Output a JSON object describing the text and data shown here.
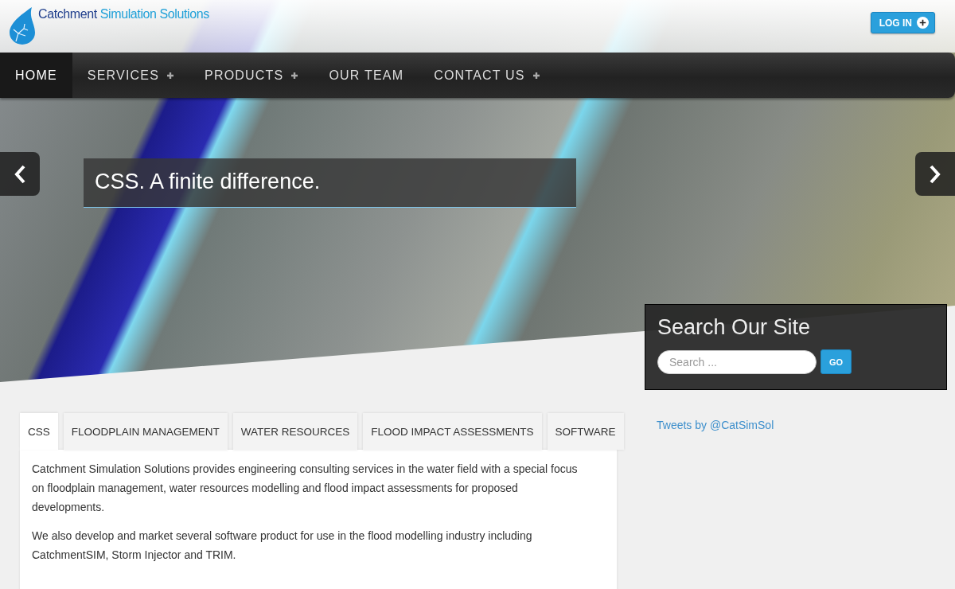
{
  "logo": {
    "name_lead": "Catchment",
    "name_rest": "Simulation Solutions"
  },
  "login_button": {
    "label": "LOG IN"
  },
  "nav": [
    {
      "label": "HOME",
      "selected": true,
      "has_submenu": false
    },
    {
      "label": "SERVICES",
      "selected": false,
      "has_submenu": true
    },
    {
      "label": "PRODUCTS",
      "selected": false,
      "has_submenu": true
    },
    {
      "label": "OUR TEAM",
      "selected": false,
      "has_submenu": false
    },
    {
      "label": "CONTACT US",
      "selected": false,
      "has_submenu": true
    }
  ],
  "slider": {
    "caption": "CSS. A finite difference."
  },
  "search": {
    "title": "Search Our Site",
    "placeholder": "Search ...",
    "button": "GO"
  },
  "tabs": [
    {
      "label": "CSS",
      "selected": true
    },
    {
      "label": "FLOODPLAIN MANAGEMENT",
      "selected": false
    },
    {
      "label": "WATER RESOURCES",
      "selected": false
    },
    {
      "label": "FLOOD IMPACT ASSESSMENTS",
      "selected": false
    },
    {
      "label": "SOFTWARE",
      "selected": false
    }
  ],
  "tab_content": {
    "paragraphs": [
      "Catchment Simulation Solutions provides engineering consulting services in the water field with a special focus on floodplain management, water resources modelling and flood impact assessments for proposed developments.",
      "We also develop and market several software product for use in the flood modelling industry including CatchmentSIM, Storm Injector and TRIM."
    ]
  },
  "sidebar": {
    "link": "Tweets by @CatSimSol"
  }
}
